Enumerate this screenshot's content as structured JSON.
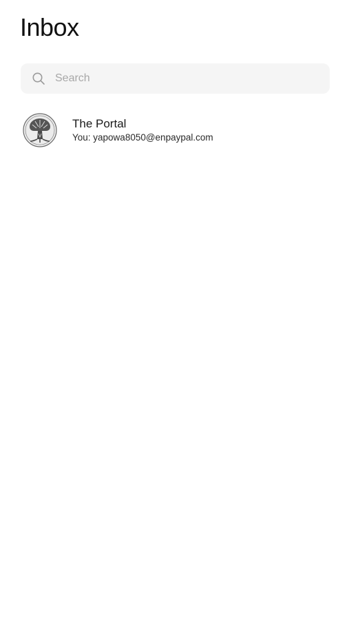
{
  "header": {
    "title": "Inbox"
  },
  "search": {
    "placeholder": "Search",
    "value": "",
    "icon": "search-icon"
  },
  "conversations": [
    {
      "name": "The Portal",
      "preview": "You: yapowa8050@enpaypal.com",
      "avatar_icon": "tree-logo"
    }
  ],
  "colors": {
    "background": "#ffffff",
    "search_bg": "#f5f5f5",
    "placeholder": "#a8a8a8",
    "text": "#111111"
  }
}
